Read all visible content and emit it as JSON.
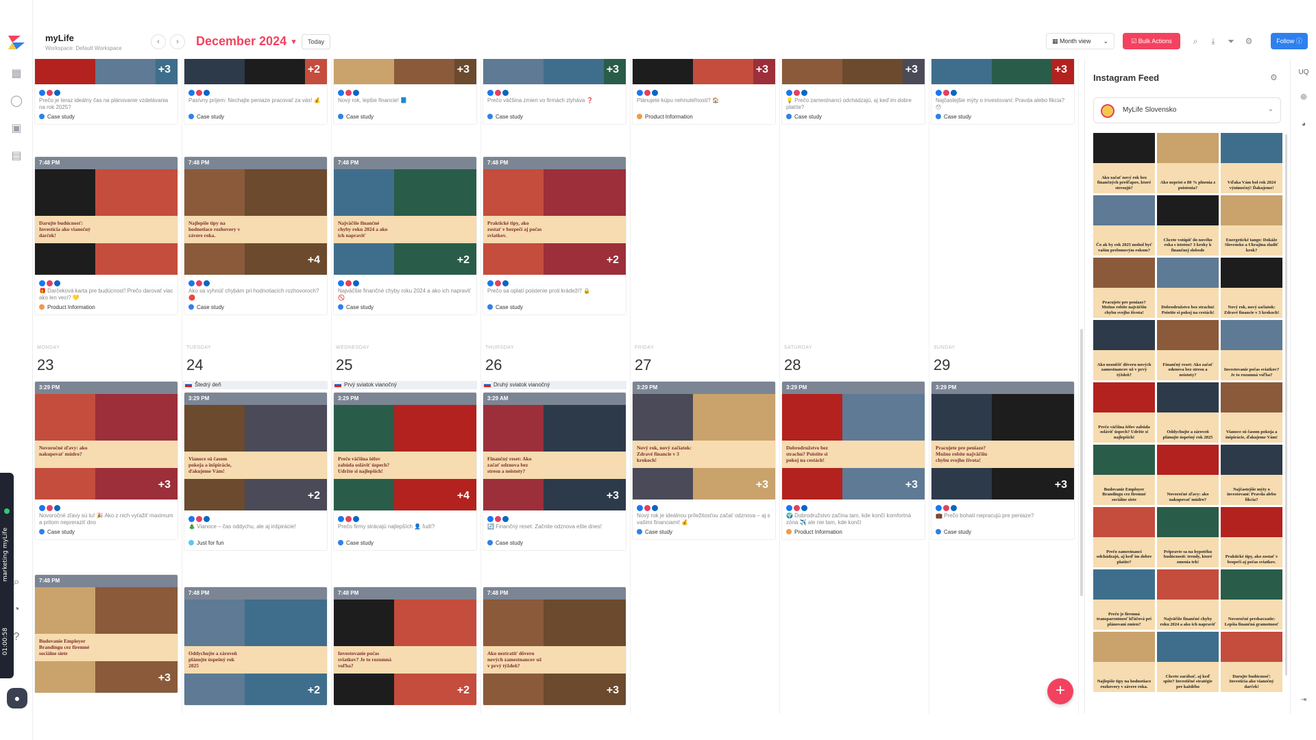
{
  "app": {
    "title": "myLife",
    "workspace": "Workspace: Default Workspace",
    "month": "December 2024",
    "today_label": "Today",
    "view_label": "Month view",
    "bulk_label": "Bulk Actions",
    "follow_label": "Follow"
  },
  "dock": {
    "timer": "01:00:58",
    "label": "marketing myLife"
  },
  "colors": {
    "accent": "#f3425f",
    "primary": "#2f80ed",
    "case_study": "#2f80ed",
    "product_info": "#f2994a",
    "just_for_fun": "#56ccf2"
  },
  "days": [
    {
      "label": "MONDAY",
      "date": "23"
    },
    {
      "label": "TUESDAY",
      "date": "24"
    },
    {
      "label": "WEDNESDAY",
      "date": "25"
    },
    {
      "label": "THURSDAY",
      "date": "26"
    },
    {
      "label": "FRIDAY",
      "date": "27"
    },
    {
      "label": "SATURDAY",
      "date": "28"
    },
    {
      "label": "SUNDAY",
      "date": "29"
    }
  ],
  "holidays": {
    "tue": "Štedrý deň",
    "wed": "Prvý sviatok vianočný",
    "thu": "Druhý sviatok vianočný"
  },
  "prev_week_top": [
    {
      "caption": "Prečo je teraz ideálny čas na plánovanie vzdelávania na rok 2025?",
      "tag": "Case study",
      "plus": "+3"
    },
    {
      "caption": "Pasívny príjem: Nechajte peniaze pracovať za vás! 💰",
      "tag": "Case study",
      "plus": "+2"
    },
    {
      "caption": "Nový rok, lepšie financie! 📘",
      "tag": "Case study",
      "plus": "+3"
    },
    {
      "caption": "Prečo väčšina zmien vo firmách zlyháva ❓",
      "tag": "Case study",
      "plus": "+3"
    },
    {
      "caption": "Plánujete kúpu nehnuteľnosti? 🏠",
      "tag": "Product Information",
      "plus": "+3"
    },
    {
      "caption": "💡 Prečo zamestnanci odchádzajú, aj keď im dobre platíte?",
      "tag": "Case study",
      "plus": "+3"
    },
    {
      "caption": "Najčastejšie mýty o investovaní: Pravda alebo fikcia? 😯",
      "tag": "Case study",
      "plus": "+3"
    }
  ],
  "prev_week_evening": [
    {
      "time": "7:48 PM",
      "title": "Darujte budúcnosť: Investícia ako vianočný darček!",
      "caption": "🎁 Darčeková karta pre budúcnosť! Prečo darovať viac ako len veci? 💛",
      "tag": "Product Information",
      "plus": ""
    },
    {
      "time": "7:48 PM",
      "title": "Najlepšie tipy na hodnotiace rozhovory v závere roka.",
      "caption": "Ako sa vyhnúť chybám pri hodnotiacich rozhovoroch? 🔴",
      "tag": "Case study",
      "plus": "+4"
    },
    {
      "time": "7:48 PM",
      "title": "Najväčšie finančné chyby roku 2024 a ako ich napraviť",
      "caption": "Najväčšie finančné chyby roku 2024 a ako ich napraviť 🚫",
      "tag": "Case study",
      "plus": "+2"
    },
    {
      "time": "7:48 PM",
      "title": "Praktické tipy, ako zostať v bezpečí aj počas sviatkov.",
      "caption": "Prečo sa oplatí poistenie proti krádeži? 🔒",
      "tag": "Case study",
      "plus": "+2"
    }
  ],
  "week_afternoon": [
    {
      "time": "3:29 PM",
      "title": "Novoročné zľavy: ako nakupovať múdro?",
      "caption": "Novoročné zľavy sú tu! 🎉 Ako z nich vyťažiť maximum a pritom nepreraziť dno",
      "tag": "Case study",
      "plus": "+3"
    },
    {
      "time": "3:29 PM",
      "title": "Vianoce sú časom pokoja a inšpirácie, ďakujeme Vám!",
      "caption": "🎄 Vianoce – čas oddychu, ale aj inšpirácie!",
      "tag": "Just for fun",
      "plus": "+2"
    },
    {
      "time": "3:29 PM",
      "title": "Prečo väčšina šéfov zabúda osláviť úspech? Udržte si najlepších!",
      "caption": "Prečo firmy strácajú najlepších 👤 ľudí?",
      "tag": "Case study",
      "plus": "+4"
    },
    {
      "time": "3:29 AM",
      "title": "Finančný reset: Ako začať odznova bez stresu a neistoty?",
      "caption": "🔄 Finančný reset: Začnite odznova ešte dnes!",
      "tag": "Case study",
      "plus": "+3"
    },
    {
      "time": "3:29 PM",
      "title": "Nový rok, nový začiatok: Zdravé financie v 3 krokoch!",
      "caption": "Nový rok je ideálnou príležitosťou začať odznova – aj s vašimi financiami! 💰",
      "tag": "Case study",
      "plus": "+3"
    },
    {
      "time": "3:29 PM",
      "title": "Dobrodružstvo bez strachu? Poistite si pokoj na cestách!",
      "caption": "🌍 Dobrodružstvo začína tam, kde končí komfortná zóna ✈️ ale nie tam, kde končí",
      "tag": "Product Information",
      "plus": "+3"
    },
    {
      "time": "3:29 PM",
      "title": "Pracujete pre peniaze? Možno robíte najväčšiu chybu svojho života!",
      "caption": "💼 Prečo bohatí nepracujú pre peniaze?",
      "tag": "Case study",
      "plus": "+3"
    }
  ],
  "week_evening": [
    {
      "time": "7:48 PM",
      "title": "Budovanie Employer Brandingu cez firemné sociálne siete",
      "plus": "+3"
    },
    {
      "time": "7:48 PM",
      "title": "Oddychujte a zároveň plánujte úspešný rok 2025",
      "plus": "+2"
    },
    {
      "time": "7:48 PM",
      "title": "Investovanie počas sviatkov? Je to rozumná voľba?",
      "plus": "+2"
    },
    {
      "time": "7:48 PM",
      "title": "Ako neztratiť dôveru nových zamestnancov už v prvý týždeň?",
      "plus": "+3"
    }
  ],
  "instagram": {
    "title": "Instagram Feed",
    "account": "MyLife Slovensko",
    "posts": [
      "Ako začať nový rok bez finančných prešľapov, ktoré stresujú?",
      "Ako nepríst o 80 % plnenia z poistenia?",
      "Vďaka Vám bol rok 2024 výnimočný! Ďakujeme!",
      "Čo ak by rok 2025 mohol byť vaším prelomovým rokom?",
      "Chcete vstúpiť do nového roka s istotou? 3 kroky k finančnej slobode",
      "Energetické tango: Dokáže Slovensko a Ukrajina zladiť krok?",
      "Pracujete pre peniaze? Možno robíte najväčšiu chybu svojho života!",
      "Dobrodružstvo bez strachu! Poistite si pokoj na cestách!",
      "Nový rok, nový začiatok: Zdravé financie v 3 krokoch!",
      "Ako nezničiť dôveru nových zamestnancov už v prvý týždeň?",
      "Finančný reset: Ako začať odznova bez stresu a neistoty?",
      "Investovanie počas sviatkov? Je to rozumná voľba?",
      "Prečo väčšina šéfov zabúda osláviť úspech? Udržte si najlepších!",
      "Oddychujte a zároveň plánujte úspešný rok 2025",
      "Vianoce sú časom pokoja a inšpirácie, ďakujeme Vám!",
      "Budovanie Employer Brandingu cez firemné sociálne siete",
      "Novoročné zľavy: ako nakupovať múdro?",
      "Najčastejšie mýty o investovaní: Pravda alebo fikcia?",
      "Prečo zamestnanci odchádzajú, aj keď im dobre platíte?",
      "Pripravte sa na hypotéku budúcnosti: trendy, ktoré zmenia trh!",
      "Praktické tipy, ako zostať v bezpečí aj počas sviatkov.",
      "Prečo je firemná transparentnosť kľúčová pri plánovaní zmien?",
      "Najväčšie finančné chyby roku 2024 a ako ich napraviť",
      "Novoročné predsavzatie: Lepšia finančná gramotnosť",
      "Najlepšie tipy na hodnotiace rozhovory v závere roka.",
      "Chcete zarábať, aj keď spíte? Investičné stratégie pre každého",
      "Darujte budúcnosť: Investícia ako vianočný darček!"
    ]
  },
  "right_rail": {
    "uq": "UQ"
  }
}
